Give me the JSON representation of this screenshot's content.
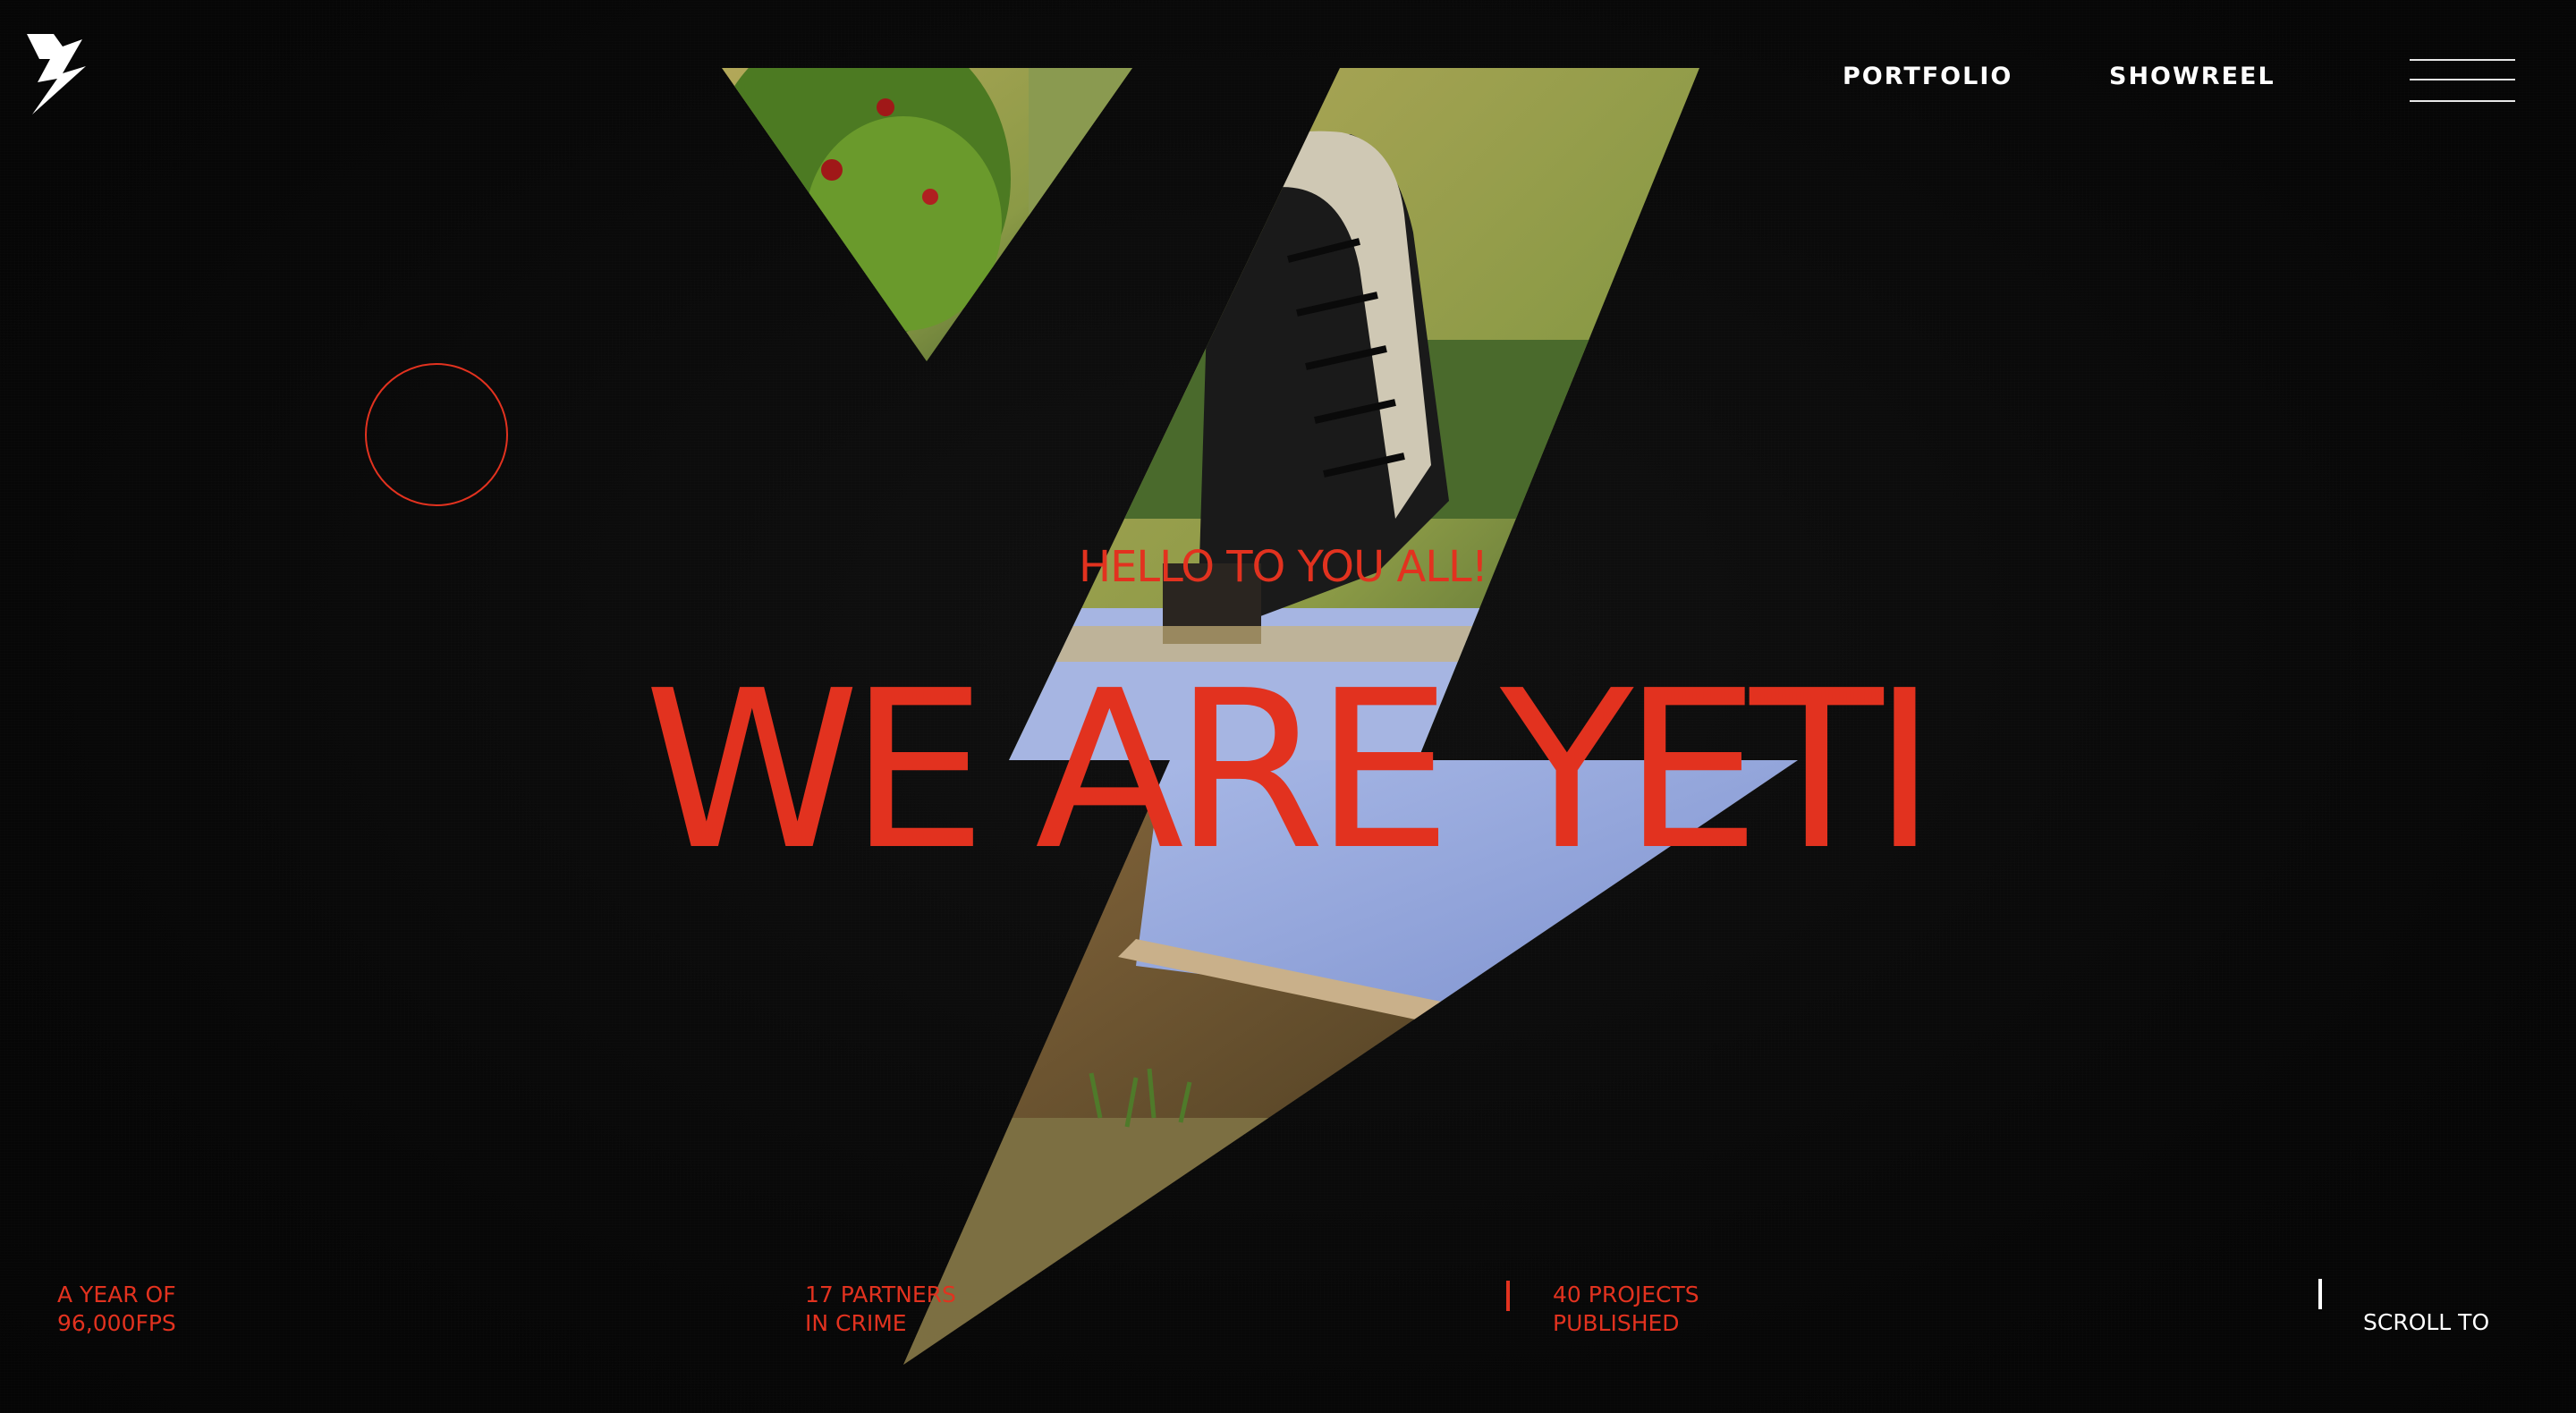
{
  "brand": {
    "logo_icon": "lightning-bolt-logo",
    "accent_color": "#e2321f"
  },
  "nav": {
    "items": [
      {
        "label": "PORTFOLIO"
      },
      {
        "label": "SHOWREEL"
      }
    ],
    "menu_icon": "hamburger-menu-icon"
  },
  "hero": {
    "greeting": "HELLO TO YOU ALL!",
    "headline": "WE ARE YETI"
  },
  "stats": [
    {
      "line1": "A YEAR OF",
      "line2": "96,000FPS"
    },
    {
      "line1": "17 PARTNERS",
      "line2": "IN CRIME"
    },
    {
      "line1": "40 PROJECTS",
      "line2": "PUBLISHED"
    }
  ],
  "scroll": {
    "label": "SCROLL TO"
  }
}
